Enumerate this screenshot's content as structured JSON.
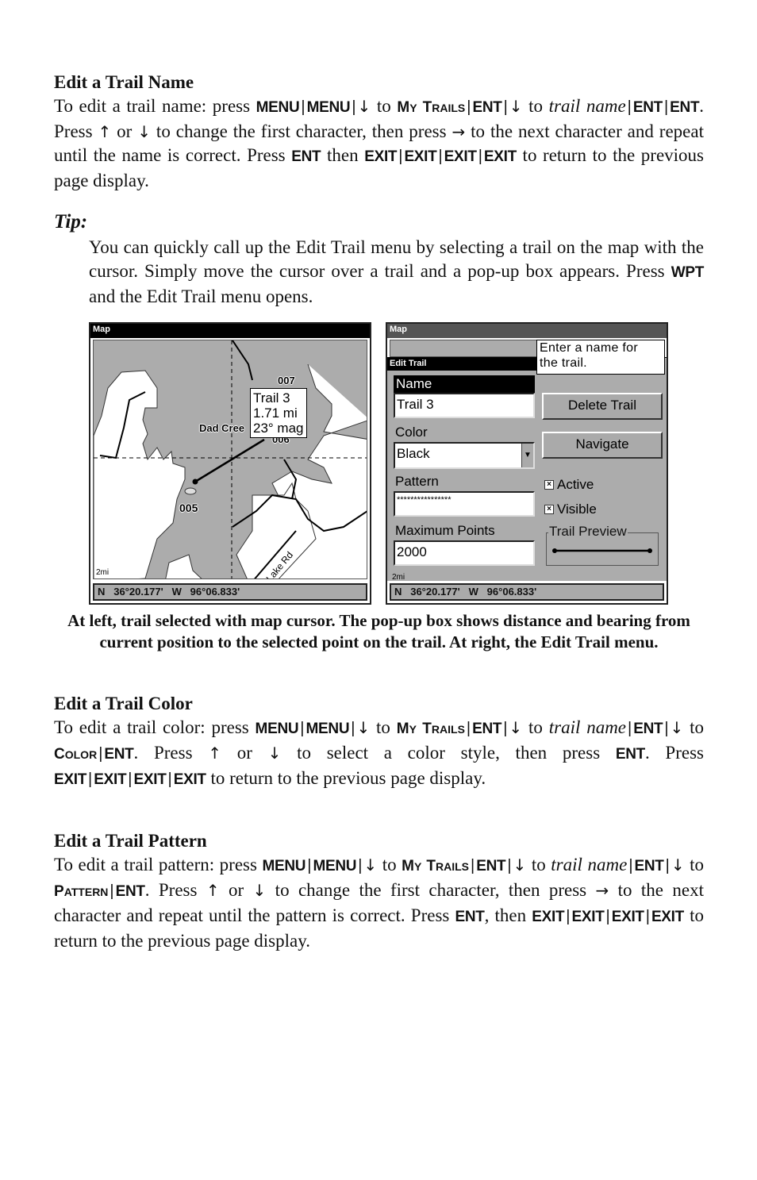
{
  "sections": {
    "name": {
      "heading": "Edit a Trail Name",
      "p": {
        "t1": "To edit a trail name: press ",
        "k_menu": "MENU",
        "sep": "|",
        "k_down": "↓",
        "k_up": "↑",
        "k_right": "→",
        "to": " to ",
        "my_trails_M": "M",
        "my_trails_y": "Y",
        "my_trails_T": " T",
        "my_trails_rails": "RAILS",
        "k_ent": "ENT",
        "trail_name_1": "trail",
        "trail_name_2": "name",
        "t2": ". Press ",
        "or": " or ",
        "t3": "  to change the first character, then press ",
        "t4": " to the next character and repeat until the name is correct. Press ",
        "then": "then ",
        "k_exit": "EXIT",
        "t5": " to return to the previous page display."
      }
    },
    "tip": {
      "label": "Tip:",
      "t1": "You can quickly call up the Edit Trail menu by selecting a trail on the map with the cursor. Simply move the cursor over a trail and a pop-up box appears. Press ",
      "k_wpt": "WPT",
      "t2": " and the Edit Trail menu opens."
    },
    "color": {
      "heading": "Edit a Trail Color",
      "t1": "To edit a trail color: press ",
      "color_C": "C",
      "color_rest": "OLOR",
      "t2": ". Press ",
      "t3": " to select a color style, then press ",
      "t4": ". Press ",
      "t5": " to return to the previous page display."
    },
    "pattern": {
      "heading": "Edit a Trail Pattern",
      "t1": "To edit a trail pattern: press ",
      "pattern_P": "P",
      "pattern_rest": "ATTERN",
      "t2": ". Press ",
      "t3": " to change the first character, then press ",
      "t4": " to the next character and repeat until the pattern is correct. Press ",
      "t5": ", then ",
      "t6": " to return to the previous page display."
    }
  },
  "left_screen": {
    "title": "Map",
    "popup": {
      "line1": "Trail 3",
      "line2": "1.71 mi",
      "line3": "23° mag"
    },
    "labels": {
      "creek": "Dad Cree",
      "wpt_007": "007",
      "wpt_006": "006",
      "wpt_005": "005",
      "road": "Lake Rd"
    },
    "scale": "2mi",
    "status": "N   36°20.177'   W   96°06.833'"
  },
  "right_screen": {
    "title": "Map",
    "dialog_title": "Edit Trail",
    "help_text_1": "Enter a name for",
    "help_text_2": "the trail.",
    "name_label": "Name",
    "name_value": "Trail 3",
    "color_label": "Color",
    "color_value": "Black",
    "pattern_label": "Pattern",
    "pattern_value": "****************",
    "max_points_label": "Maximum Points",
    "max_points_value": "2000",
    "delete_button": "Delete Trail",
    "navigate_button": "Navigate",
    "active_label": "Active",
    "active_checked": true,
    "visible_label": "Visible",
    "visible_checked": true,
    "check_mark": "×",
    "preview_label": "Trail Preview",
    "scale": "2mi",
    "status": "N   36°20.177'   W   96°06.833'"
  },
  "caption": "At left, trail selected with map cursor. The pop-up box shows distance and bearing from current position to the selected point on the trail. At right, the Edit Trail menu.",
  "colors": {
    "map_gray": "#acacac",
    "ink": "#000000",
    "paper": "#ffffff"
  }
}
